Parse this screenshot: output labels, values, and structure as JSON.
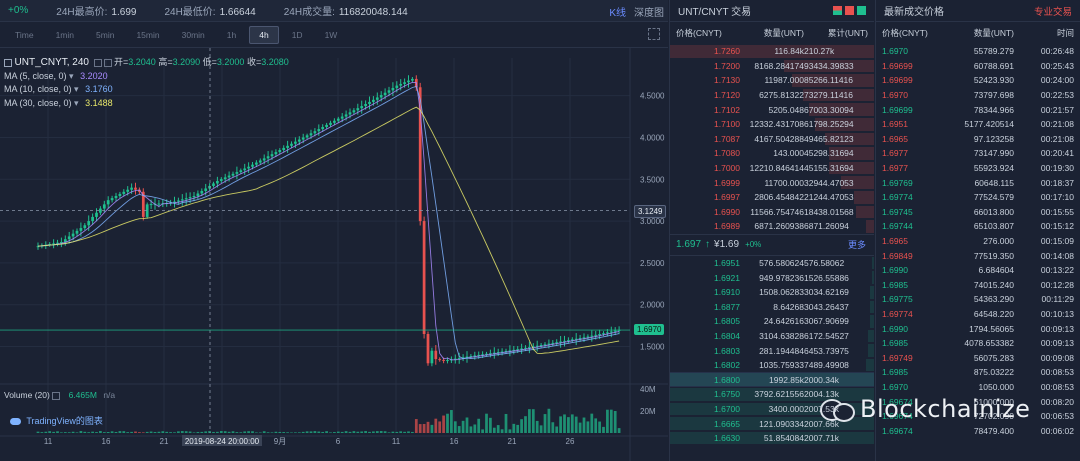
{
  "topbar": {
    "change": "+0%",
    "high_label": "24H最高价:",
    "high_value": "1.699",
    "low_label": "24H最低价:",
    "low_value": "1.66644",
    "volume_label": "24H成交量:",
    "volume_value": "116820048.144",
    "tab_kline": "K线",
    "tab_depth": "深度图"
  },
  "timeframes": [
    "Time",
    "1min",
    "5min",
    "15min",
    "30min",
    "1h",
    "4h",
    "1D",
    "1W"
  ],
  "active_timeframe": "4h",
  "legend": {
    "symbol": "UNT_CNYT, 240",
    "open_label": "开=",
    "open": "3.2040",
    "high_label": "高=",
    "high": "3.2090",
    "low_label": "低=",
    "low": "3.2000",
    "close_label": "收=",
    "close": "3.2080",
    "ma": [
      {
        "label": "MA (5, close, 0)",
        "value": "3.2020",
        "color": "#a98bff"
      },
      {
        "label": "MA (10, close, 0)",
        "value": "3.1760",
        "color": "#7fb3ff"
      },
      {
        "label": "MA (30, close, 0)",
        "value": "3.1488",
        "color": "#e6e66a"
      }
    ],
    "volume_label": "Volume (20)",
    "volume_value": "6.465M",
    "volume_na": "n/a",
    "tv_logo": "TradingView的图表"
  },
  "chart_data": {
    "type": "candlestick",
    "price_axis": [
      "4.5000",
      "4.0000",
      "3.5000",
      "3.0000",
      "2.5000",
      "2.0000",
      "1.5000"
    ],
    "volume_axis": [
      "40M",
      "20M"
    ],
    "ylim": [
      1.1,
      4.95
    ],
    "crosshair_price": "3.1249",
    "last_price_tag": "1.6970",
    "x_ticks": [
      "11",
      "16",
      "21",
      "2019-08-24 20:00:00",
      "9月",
      "6",
      "11",
      "16",
      "21",
      "26"
    ],
    "colors": {
      "up": "#1fbf8f",
      "down": "#e8524f",
      "ma5": "#a98bff",
      "ma10": "#7fb3ff",
      "ma30": "#e6e66a"
    },
    "trend_points": [
      [
        0,
        2.7
      ],
      [
        6,
        2.75
      ],
      [
        12,
        2.95
      ],
      [
        18,
        3.25
      ],
      [
        24,
        3.4
      ],
      [
        26,
        3.35
      ],
      [
        27,
        3.05
      ],
      [
        28,
        3.2
      ],
      [
        34,
        3.22
      ],
      [
        40,
        3.3
      ],
      [
        46,
        3.48
      ],
      [
        54,
        3.65
      ],
      [
        62,
        3.85
      ],
      [
        70,
        4.05
      ],
      [
        78,
        4.25
      ],
      [
        86,
        4.45
      ],
      [
        92,
        4.62
      ],
      [
        96,
        4.7
      ],
      [
        97,
        4.6
      ],
      [
        98,
        3.0
      ],
      [
        99,
        1.65
      ],
      [
        100,
        1.3
      ],
      [
        101,
        1.45
      ],
      [
        102,
        1.35
      ],
      [
        104,
        1.33
      ],
      [
        110,
        1.38
      ],
      [
        116,
        1.42
      ],
      [
        122,
        1.46
      ],
      [
        128,
        1.51
      ],
      [
        134,
        1.56
      ],
      [
        140,
        1.61
      ],
      [
        146,
        1.67
      ],
      [
        149,
        1.7
      ]
    ]
  },
  "orderbook": {
    "title": "UNT/CNYT 交易",
    "col_price": "价格(CNYT)",
    "col_amount": "数量(UNT)",
    "col_total": "累计(UNT)",
    "asks": [
      [
        "1.7260",
        "116.84k",
        "210.27k",
        1.0
      ],
      [
        "1.7200",
        "8168.284174",
        "93434.39833",
        0.44
      ],
      [
        "1.7130",
        "11987.000",
        "85266.11416",
        0.4
      ],
      [
        "1.7120",
        "6275.81322",
        "73279.11416",
        0.35
      ],
      [
        "1.7102",
        "5205.048",
        "67003.30094",
        0.32
      ],
      [
        "1.7100",
        "12332.431708",
        "61798.25294",
        0.29
      ],
      [
        "1.7087",
        "4167.504288",
        "49465.82123",
        0.24
      ],
      [
        "1.7080",
        "143.000",
        "45298.31694",
        0.22
      ],
      [
        "1.7000",
        "12210.846414",
        "45155.31694",
        0.22
      ],
      [
        "1.6999",
        "11700.000",
        "32944.47053",
        0.16
      ],
      [
        "1.6997",
        "2806.454842",
        "21244.47053",
        0.1
      ],
      [
        "1.6990",
        "11566.754746",
        "18438.01568",
        0.09
      ],
      [
        "1.6989",
        "6871.260938",
        "6871.26094",
        0.04
      ]
    ],
    "last_price": "1.697",
    "last_arrow": "↑",
    "last_cny": "¥1.69",
    "last_change": "+0%",
    "more": "更多",
    "bids": [
      [
        "1.6951",
        "576.580624",
        "576.58062",
        0.01
      ],
      [
        "1.6921",
        "949.978236",
        "1526.55886",
        0.01
      ],
      [
        "1.6910",
        "1508.06283",
        "3034.62169",
        0.02
      ],
      [
        "1.6877",
        "8.64268",
        "3043.26437",
        0.02
      ],
      [
        "1.6805",
        "24.642616",
        "3067.90699",
        0.02
      ],
      [
        "1.6804",
        "3104.63828",
        "6172.54527",
        0.03
      ],
      [
        "1.6803",
        "281.194484",
        "6453.73975",
        0.03
      ],
      [
        "1.6802",
        "1035.75933",
        "7489.49908",
        0.04
      ],
      [
        "1.6800",
        "1992.85k",
        "2000.34k",
        1.0
      ],
      [
        "1.6750",
        "3792.621556",
        "2004.13k",
        1.0
      ],
      [
        "1.6700",
        "3400.000",
        "2007.53k",
        1.0
      ],
      [
        "1.6665",
        "121.090334",
        "2007.66k",
        1.0
      ],
      [
        "1.6630",
        "51.854084",
        "2007.71k",
        1.0
      ]
    ]
  },
  "trades": {
    "title": "最新成交价格",
    "pro": "专业交易",
    "col_price": "价格(CNYT)",
    "col_amount": "数量(UNT)",
    "col_time": "时间",
    "rows": [
      [
        "1.6970",
        "55789.279",
        "00:26:48",
        "up"
      ],
      [
        "1.69699",
        "60788.691",
        "00:25:43",
        "down"
      ],
      [
        "1.69699",
        "52423.930",
        "00:24:00",
        "down"
      ],
      [
        "1.6970",
        "73797.698",
        "00:22:53",
        "down"
      ],
      [
        "1.69699",
        "78344.966",
        "00:21:57",
        "up"
      ],
      [
        "1.6951",
        "5177.420514",
        "00:21:08",
        "down"
      ],
      [
        "1.6965",
        "97.123258",
        "00:21:08",
        "down"
      ],
      [
        "1.6977",
        "73147.990",
        "00:20:41",
        "down"
      ],
      [
        "1.6977",
        "55923.924",
        "00:19:30",
        "down"
      ],
      [
        "1.69769",
        "60648.115",
        "00:18:37",
        "up"
      ],
      [
        "1.69774",
        "77524.579",
        "00:17:10",
        "up"
      ],
      [
        "1.69745",
        "66013.800",
        "00:15:55",
        "up"
      ],
      [
        "1.69744",
        "65103.807",
        "00:15:12",
        "up"
      ],
      [
        "1.6965",
        "276.000",
        "00:15:09",
        "down"
      ],
      [
        "1.69849",
        "77519.350",
        "00:14:08",
        "down"
      ],
      [
        "1.6990",
        "6.684604",
        "00:13:22",
        "up"
      ],
      [
        "1.6985",
        "74015.240",
        "00:12:28",
        "up"
      ],
      [
        "1.69775",
        "54363.290",
        "00:11:29",
        "up"
      ],
      [
        "1.69774",
        "64548.220",
        "00:10:13",
        "down"
      ],
      [
        "1.6990",
        "1794.56065",
        "00:09:13",
        "up"
      ],
      [
        "1.6985",
        "4078.653382",
        "00:09:13",
        "up"
      ],
      [
        "1.69749",
        "56075.283",
        "00:09:08",
        "down"
      ],
      [
        "1.6985",
        "875.03222",
        "00:08:53",
        "up"
      ],
      [
        "1.6970",
        "1050.000",
        "00:08:53",
        "up"
      ],
      [
        "1.69674",
        "61000.000",
        "00:08:20",
        "up"
      ],
      [
        "1.69674",
        "72702.090",
        "00:06:53",
        "up"
      ],
      [
        "1.69674",
        "78479.400",
        "00:06:02",
        "up"
      ]
    ]
  },
  "watermark": "Blockchainize"
}
